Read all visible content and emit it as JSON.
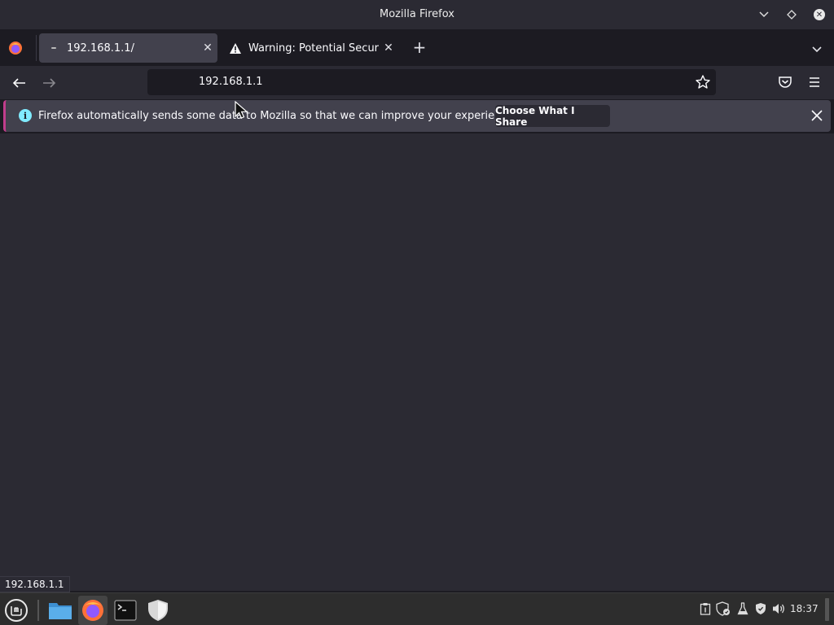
{
  "window": {
    "title": "Mozilla Firefox"
  },
  "tabs": [
    {
      "label": "192.168.1.1/",
      "active": true
    },
    {
      "label": "Warning: Potential Security",
      "active": false
    }
  ],
  "navbar": {
    "url": "192.168.1.1"
  },
  "notification": {
    "message": "Firefox automatically sends some data to Mozilla so that we can improve your experience.",
    "button_label": "Choose What I Share"
  },
  "status": {
    "link": "192.168.1.1"
  },
  "taskbar": {
    "clock": "18:37"
  },
  "icons": {
    "window_minimize": "chevron-down-icon",
    "window_maximize": "diamond-icon",
    "window_close": "close-circle-icon",
    "info": "info-icon",
    "warning": "warning-icon"
  },
  "colors": {
    "accent_stripe": "#c13d8c",
    "info_icon": "#80ebff",
    "chrome_bg": "#2b2a33",
    "tab_active_bg": "#42414d"
  }
}
